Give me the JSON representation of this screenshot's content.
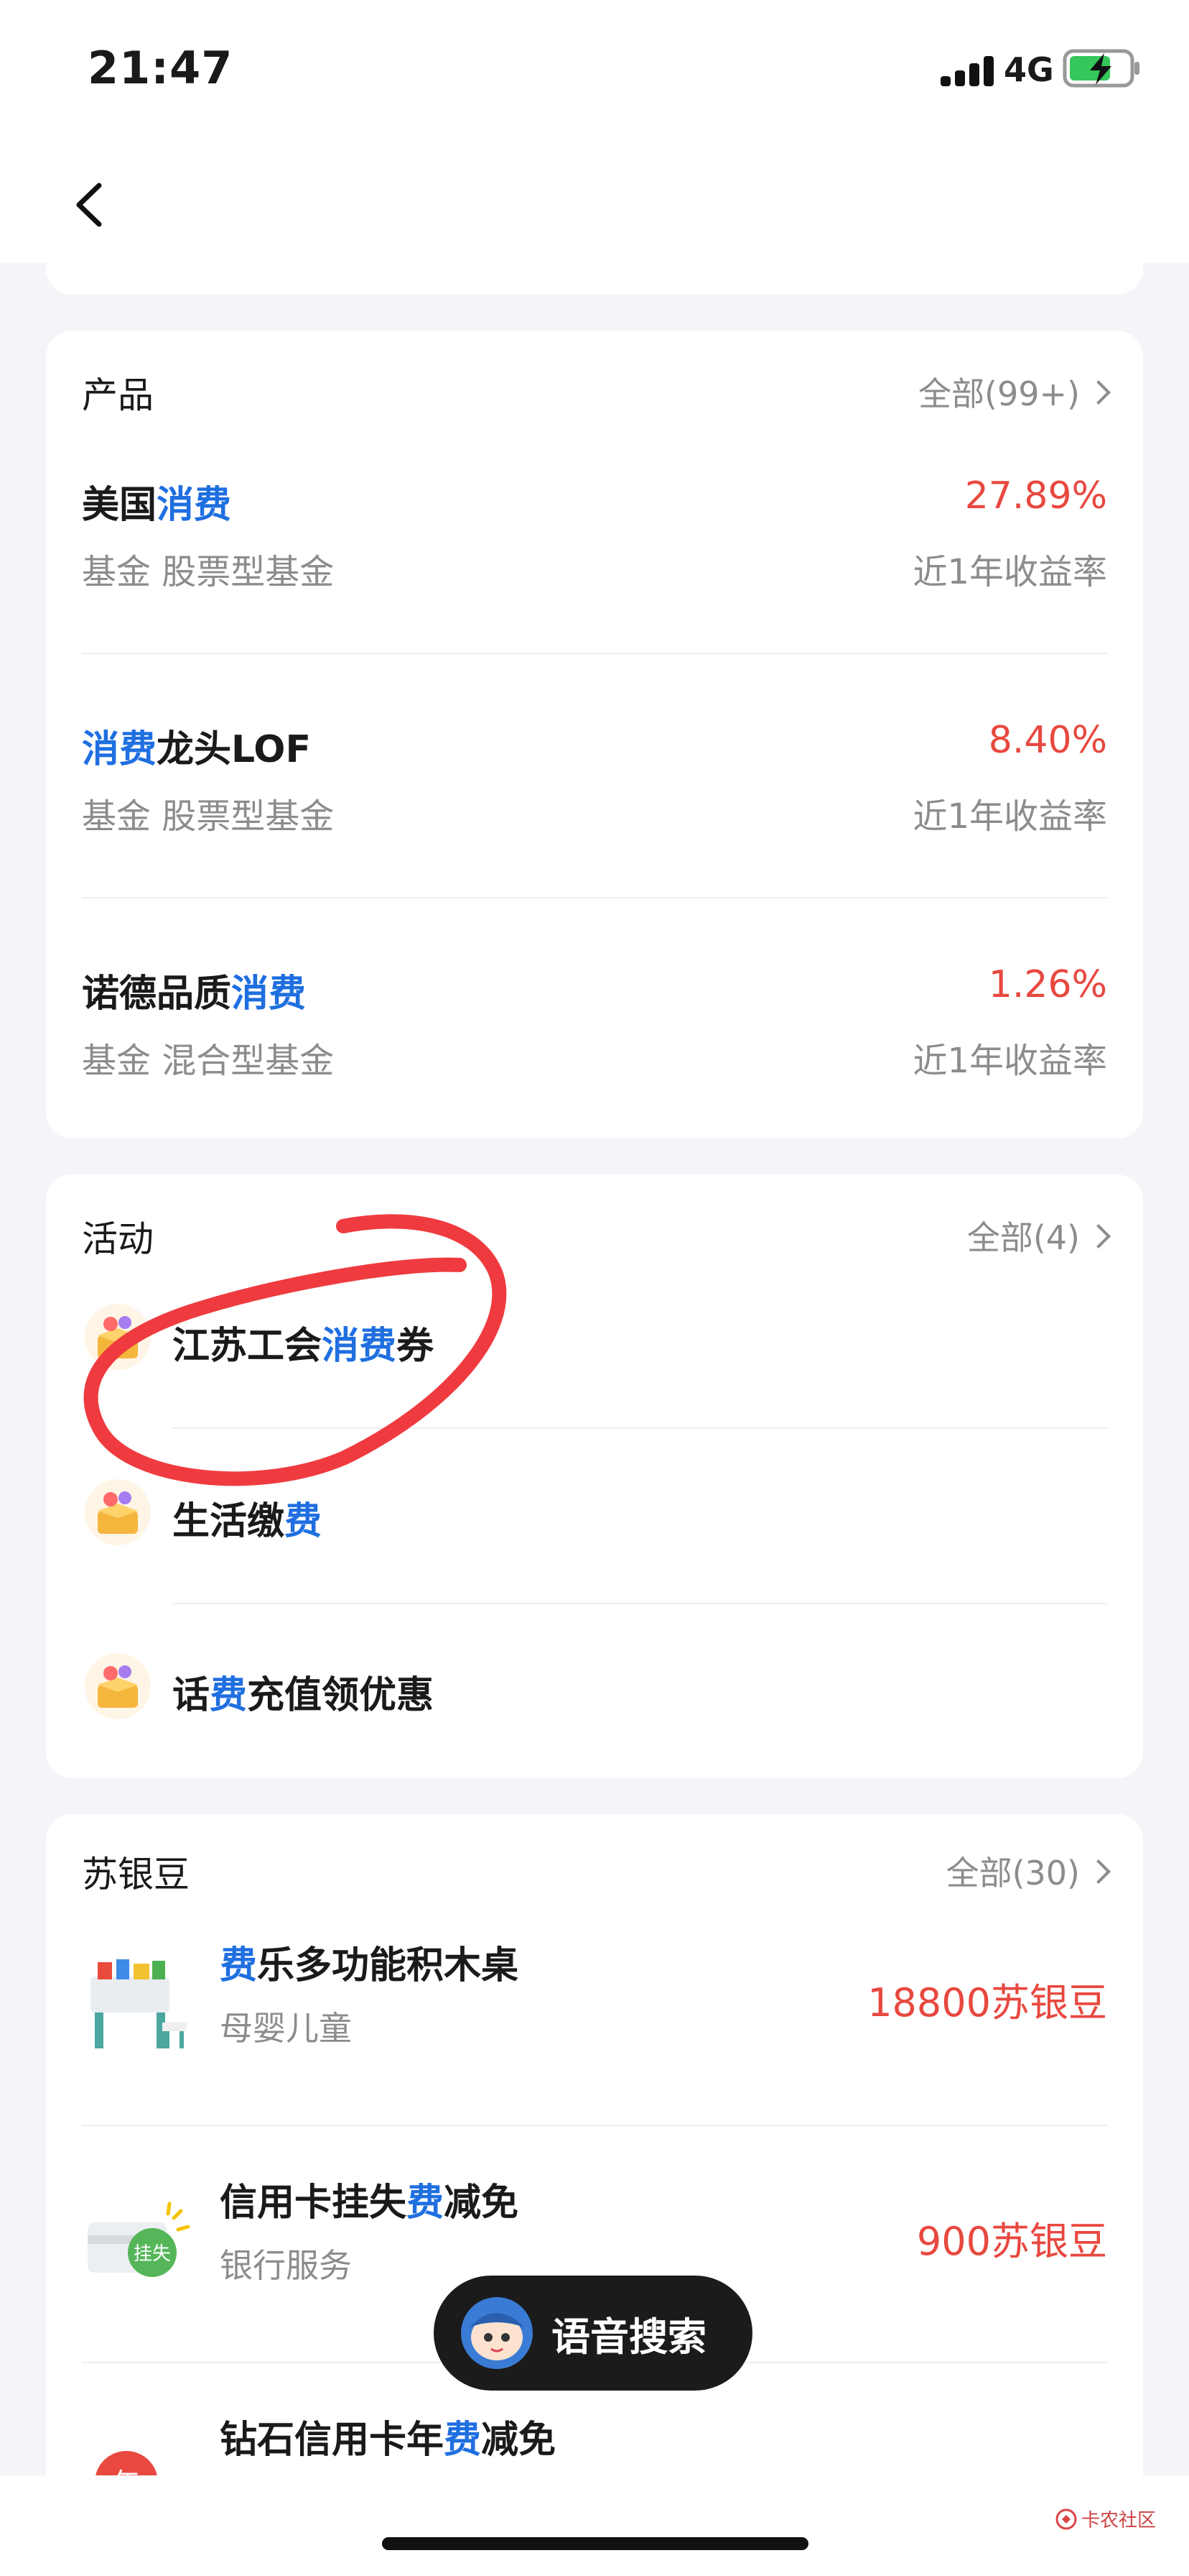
{
  "status_bar": {
    "time": "21:47",
    "network": "4G"
  },
  "products": {
    "title": "产品",
    "more": "全部(99+)",
    "items": [
      {
        "name_parts": [
          "美国",
          "消费",
          ""
        ],
        "value": "27.89%",
        "sub": "基金 股票型基金",
        "value_label": "近1年收益率"
      },
      {
        "name_parts": [
          "",
          "消费",
          "龙头LOF"
        ],
        "value": "8.40%",
        "sub": "基金 股票型基金",
        "value_label": "近1年收益率"
      },
      {
        "name_parts": [
          "诺德品质",
          "消费",
          ""
        ],
        "value": "1.26%",
        "sub": "基金 混合型基金",
        "value_label": "近1年收益率"
      }
    ]
  },
  "activities": {
    "title": "活动",
    "more": "全部(4)",
    "items": [
      {
        "parts": [
          "江苏工会",
          "消费",
          "券"
        ]
      },
      {
        "parts": [
          "生活缴",
          "费",
          ""
        ]
      },
      {
        "parts": [
          "话",
          "费",
          "充值领优惠"
        ]
      }
    ]
  },
  "beans": {
    "title": "苏银豆",
    "more": "全部(30)",
    "items": [
      {
        "parts": [
          "",
          "费",
          "乐多功能积木桌"
        ],
        "sub": "母婴儿童",
        "value": "18800苏银豆"
      },
      {
        "parts": [
          "信用卡挂失",
          "费",
          "减免"
        ],
        "sub": "银行服务",
        "value": "900苏银豆",
        "icon_text": "挂失"
      },
      {
        "parts": [
          "钻石信用卡年",
          "费",
          "减免"
        ],
        "icon_text": "年"
      }
    ]
  },
  "voice_search": {
    "label": "语音搜索"
  },
  "watermark": {
    "text": "卡农社区"
  },
  "colors": {
    "highlight": "#1f6fe0",
    "value_red": "#e8483f",
    "annotation_red": "#ef3b3f"
  }
}
